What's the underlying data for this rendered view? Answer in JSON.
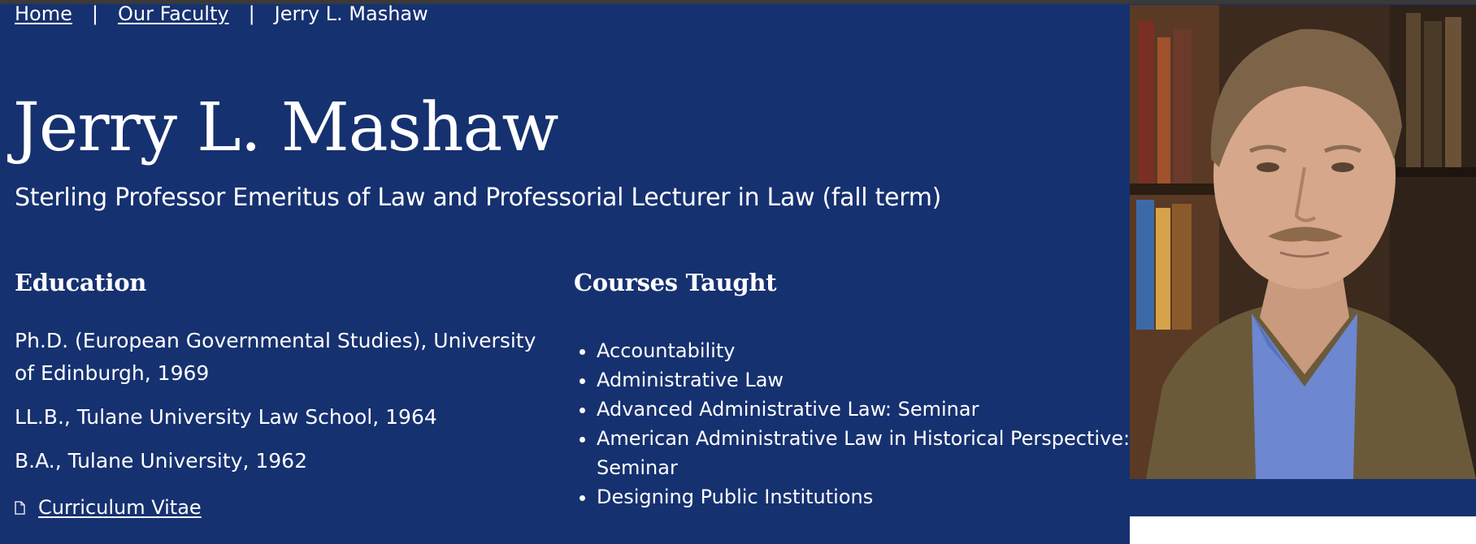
{
  "breadcrumb": {
    "home": "Home",
    "separator": "|",
    "faculty": "Our Faculty",
    "current": "Jerry L. Mashaw"
  },
  "profile": {
    "name": "Jerry L. Mashaw",
    "title": "Sterling Professor Emeritus of Law and Professorial Lecturer in Law (fall term)"
  },
  "education": {
    "heading": "Education",
    "items": [
      "Ph.D. (European Governmental Studies), University of Edinburgh, 1969",
      "LL.B., Tulane University Law School, 1964",
      "B.A., Tulane University, 1962"
    ],
    "cv_link": "Curriculum Vitae",
    "cv_icon": "document-icon"
  },
  "courses": {
    "heading": "Courses Taught",
    "items": [
      "Accountability",
      "Administrative Law",
      "Advanced Administrative Law: Seminar",
      "American Administrative Law in Historical Perspective: Seminar",
      "Designing Public Institutions"
    ]
  },
  "colors": {
    "background": "#163170",
    "text": "#ffffff"
  }
}
